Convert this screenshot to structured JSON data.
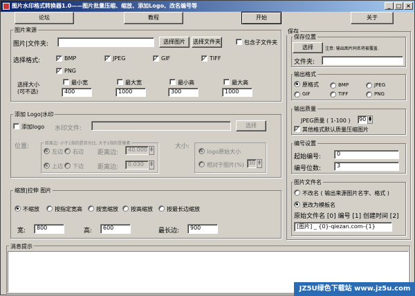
{
  "window": {
    "title": "图片水印格式转换器1.0——图片批量压缩、缩放、添加Logo、改名编号等",
    "min": "_",
    "max": "□",
    "close": "×"
  },
  "toolbar": {
    "forum": "论坛",
    "tutorial": "教程",
    "start": "开始",
    "about": "关于"
  },
  "source": {
    "title": "图片来源",
    "path_label": "图片|文件夹:",
    "path_value": "",
    "select_image": "选择图片",
    "select_folder": "选择文件夹",
    "include_sub": "包含子文件夹",
    "formats_label": "选择格式:",
    "formats": [
      {
        "name": "BMP",
        "checked": true
      },
      {
        "name": "JPEG",
        "checked": true
      },
      {
        "name": "GIF",
        "checked": true
      },
      {
        "name": "TIFF",
        "checked": true
      },
      {
        "name": "PNG",
        "checked": true
      }
    ],
    "size_label": "选择大小",
    "size_label2": "(可不选)",
    "sizes": [
      {
        "label": "最小宽",
        "value": "400",
        "checked": false
      },
      {
        "label": "最大宽",
        "value": "1000",
        "checked": false
      },
      {
        "label": "最小高",
        "value": "300",
        "checked": false
      },
      {
        "label": "最大高",
        "value": "1000",
        "checked": false
      }
    ]
  },
  "logo": {
    "title": "添加 Logo|水印",
    "add_logo": "添加logo",
    "watermark_file_label": "水印文件:",
    "watermark_file_value": "",
    "select": "选择",
    "position_label": "位置:",
    "edge_hint": "距离边: 小于1指的是百分比, 大于1指的是像素",
    "left": "左边",
    "right": "右边",
    "top": "上边",
    "bottom": "下边",
    "hdist_label": "距离边:",
    "hdist": "40.000",
    "vdist_label": "距离边:",
    "vdist": "0.030",
    "size_label": "大小:",
    "orig_size": "logo原始大小",
    "relative": "相对于图片(%)",
    "relative_value": "30"
  },
  "scale": {
    "title": "缩放|拉伸 图片",
    "options": [
      {
        "label": "不缩放",
        "on": true
      },
      {
        "label": "按指定宽高",
        "on": false
      },
      {
        "label": "按宽缩放",
        "on": false
      },
      {
        "label": "按高缩放",
        "on": false
      },
      {
        "label": "按最长边缩放",
        "on": false
      }
    ],
    "width_label": "宽:",
    "width": "800",
    "height_label": "高:",
    "height": "600",
    "longest_label": "最长边:",
    "longest": "900"
  },
  "save": {
    "title": "保存",
    "loc_title": "保存位置",
    "select": "选择",
    "note": "注意: 输出图片同名将被覆盖.",
    "folder_label": "文件夹:",
    "folder_value": "",
    "fmt_title": "输出格式",
    "formats": [
      {
        "label": "原格式",
        "on": true
      },
      {
        "label": "BMP",
        "on": false
      },
      {
        "label": "JPEG",
        "on": false
      },
      {
        "label": "GIF",
        "on": false
      },
      {
        "label": "TIFF",
        "on": false
      },
      {
        "label": "PNG",
        "on": false
      }
    ],
    "quality_title": "输出质量",
    "jpeg_label": "JPEG质量 ( 1-100 )",
    "jpeg_value": "90",
    "quality_other": "其他格式默认质量压缩图片",
    "num_title": "编号设置",
    "start_label": "起始编号:",
    "start_value": "0",
    "digits_label": "编号位数:",
    "digits_value": "3",
    "name_title": "图片文件名",
    "keep_name": "不改名 ( 输出来源图片名字、格式 )",
    "template_label": "更改为模板名",
    "template_tokens": "原始文件名 [0]  编号 [1]  创建时间 [2]",
    "template_value": "[图片] _ {0}-qiezan.com-{1}"
  },
  "log": {
    "title": "消息提示"
  },
  "watermark": {
    "text": "JZ5U绿色下载站 www.jz5u.com"
  }
}
